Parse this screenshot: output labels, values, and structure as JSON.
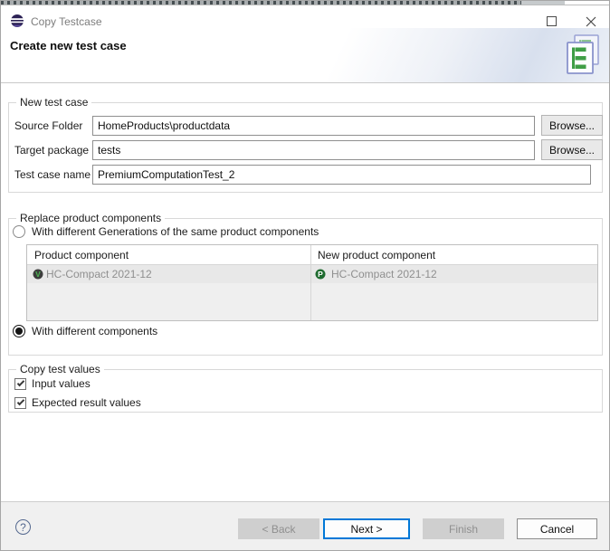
{
  "window": {
    "title": "Copy Testcase"
  },
  "header": {
    "title": "Create new test case"
  },
  "new_test_case": {
    "group_title": "New test case",
    "source_folder_label": "Source Folder",
    "source_folder_value": "HomeProducts\\productdata",
    "browse_label": "Browse...",
    "target_package_label": "Target package",
    "target_package_value": "tests",
    "test_case_name_label": "Test case name",
    "test_case_name_value": "PremiumComputationTest_2"
  },
  "replace_components": {
    "group_title": "Replace product components",
    "radio_generations_label": "With different Generations of the same product components",
    "radio_generations_selected": false,
    "radio_components_label": "With different components",
    "radio_components_selected": true,
    "table": {
      "columns": [
        "Product component",
        "New product component"
      ],
      "rows": [
        {
          "product_component": "HC-Compact 2021-12",
          "product_icon_letter": "V",
          "new_product_component": "HC-Compact 2021-12",
          "new_product_icon_letter": "P"
        }
      ]
    }
  },
  "copy_test_values": {
    "group_title": "Copy test values",
    "checkboxes": [
      {
        "label": "Input values",
        "checked": true
      },
      {
        "label": "Expected result values",
        "checked": true
      }
    ]
  },
  "footer": {
    "help_label": "?",
    "back_label": "< Back",
    "next_label": "Next >",
    "finish_label": "Finish",
    "cancel_label": "Cancel"
  },
  "colors": {
    "accent": "#0078d7",
    "icon_green": "#3f9e46",
    "icon_dark_green": "#1e6b2f",
    "banner_tint": "#d8e0ee",
    "disabled_button_bg": "#cfcfcf"
  }
}
